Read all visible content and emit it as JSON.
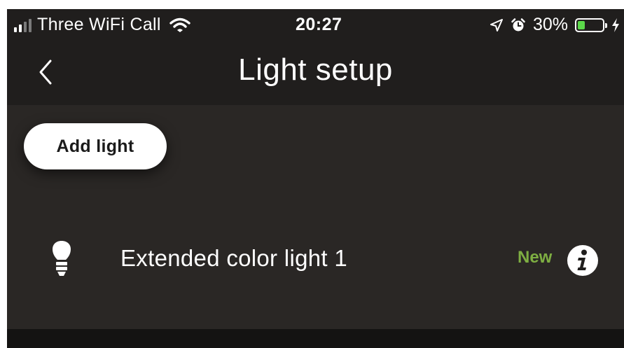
{
  "status_bar": {
    "carrier": "Three WiFi Call",
    "time": "20:27",
    "battery_percent": "30%",
    "battery_level": 0.3,
    "signal_bars": 4,
    "signal_bars_active": 2,
    "icons": [
      "signal-icon",
      "wifi-icon",
      "location-arrow-icon",
      "alarm-icon",
      "battery-icon",
      "charging-bolt-icon"
    ]
  },
  "nav": {
    "title": "Light setup",
    "back_icon": "chevron-left-icon"
  },
  "main": {
    "add_light_label": "Add light",
    "lights": [
      {
        "name": "Extended color light 1",
        "badge": "New",
        "icon": "bulb-icon",
        "action_icon": "info-icon"
      }
    ]
  },
  "colors": {
    "background": "#201e1d",
    "content_background": "#2a2725",
    "badge_green": "#7eae42",
    "battery_green": "#5bd84a"
  }
}
